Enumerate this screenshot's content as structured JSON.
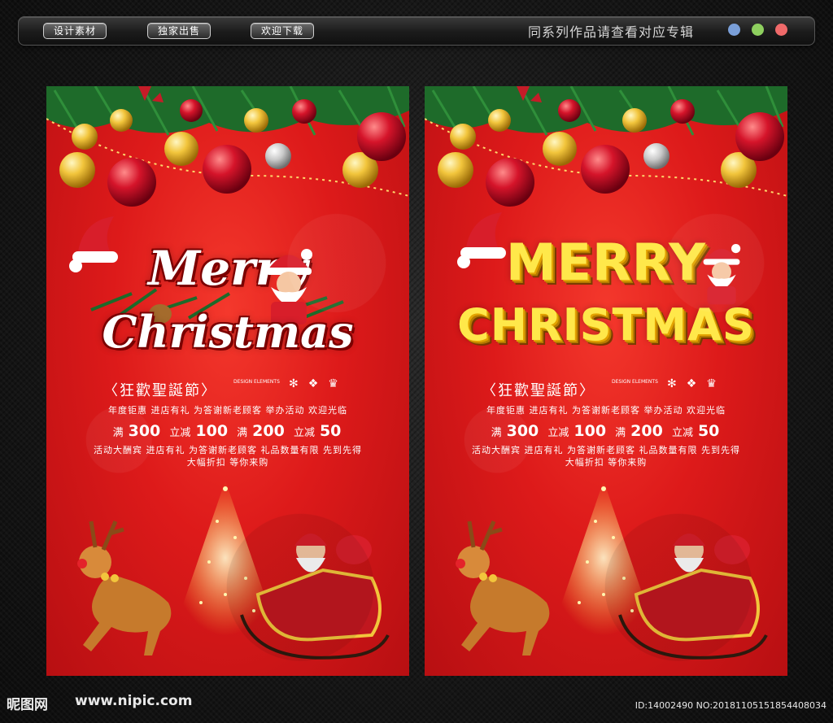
{
  "toolbar": {
    "buttons": [
      "设计素材",
      "独家出售",
      "欢迎下载"
    ],
    "note": "同系列作品请查看对应专辑",
    "dot_colors": [
      "#7a9fd8",
      "#8ecf5f",
      "#f06a6a"
    ]
  },
  "poster_left": {
    "title_line1": "Merry",
    "title_line2": "Christmas",
    "festival": "〈狂歡聖誕節〉",
    "design_elements": "DESIGN ELEMENTS",
    "line1": "年度钜惠 进店有礼 为答谢新老顾客 举办活动 欢迎光临",
    "promo": [
      {
        "k": "满",
        "v": "300"
      },
      {
        "k": "立减",
        "v": "100"
      },
      {
        "k": "满",
        "v": "200"
      },
      {
        "k": "立减",
        "v": "50"
      }
    ],
    "line3": "活动大酬宾 进店有礼 为答谢新老顾客 礼品数量有限 先到先得",
    "line4": "大幅折扣 等你来购"
  },
  "poster_right": {
    "title_line1": "MERRY",
    "title_line2": "CHRISTMAS",
    "festival": "〈狂歡聖誕節〉",
    "design_elements": "DESIGN ELEMENTS",
    "line1": "年度钜惠 进店有礼 为答谢新老顾客 举办活动 欢迎光临",
    "promo": [
      {
        "k": "满",
        "v": "300"
      },
      {
        "k": "立减",
        "v": "100"
      },
      {
        "k": "满",
        "v": "200"
      },
      {
        "k": "立减",
        "v": "50"
      }
    ],
    "line3": "活动大酬宾 进店有礼 为答谢新老顾客 礼品数量有限 先到先得",
    "line4": "大幅折扣 等你来购"
  },
  "watermark": {
    "logo": "昵图网",
    "url": "www.nipic.com",
    "id": "ID:14002490 NO:20181105151854408034"
  }
}
